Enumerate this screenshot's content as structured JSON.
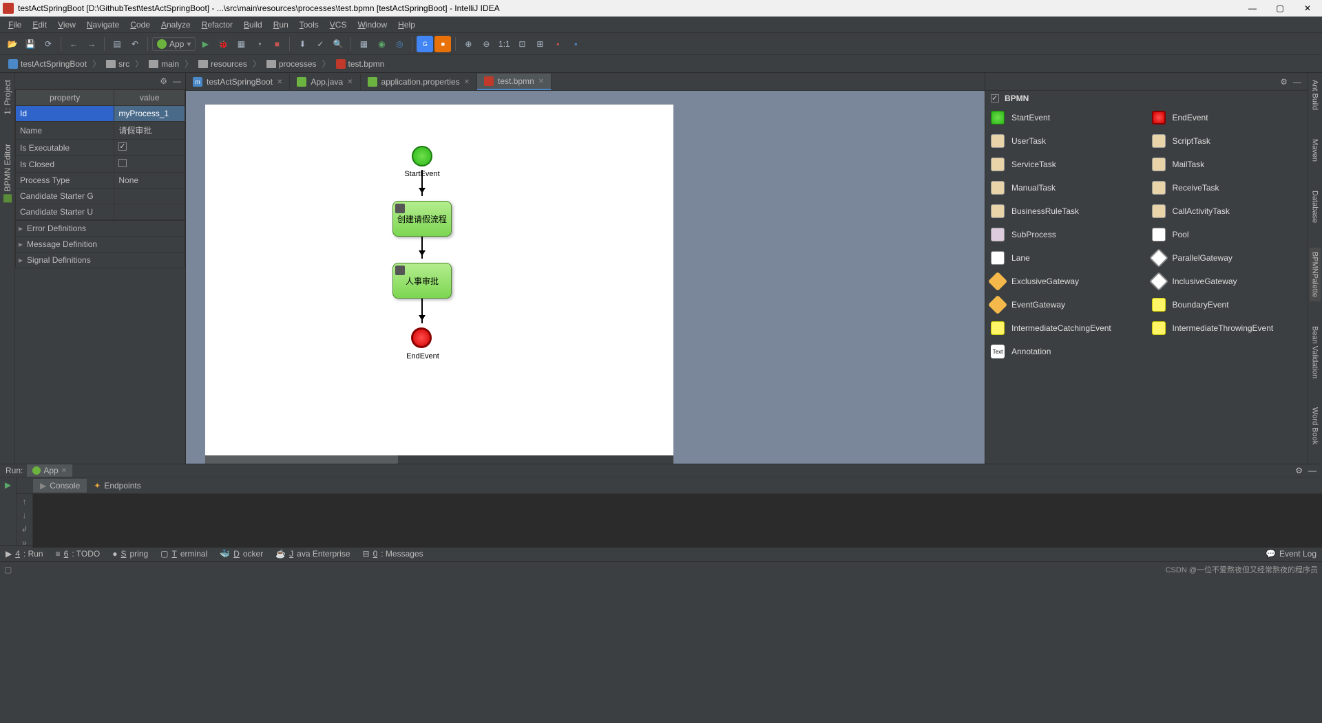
{
  "window": {
    "title": "testActSpringBoot [D:\\GithubTest\\testActSpringBoot] - ...\\src\\main\\resources\\processes\\test.bpmn [testActSpringBoot] - IntelliJ IDEA"
  },
  "menu": [
    "File",
    "Edit",
    "View",
    "Navigate",
    "Code",
    "Analyze",
    "Refactor",
    "Build",
    "Run",
    "Tools",
    "VCS",
    "Window",
    "Help"
  ],
  "run_config": "App",
  "breadcrumb": [
    "testActSpringBoot",
    "src",
    "main",
    "resources",
    "processes",
    "test.bpmn"
  ],
  "left_tabs": [
    "1: Project",
    "BPMN Editor"
  ],
  "right_tabs": [
    "Ant Build",
    "Maven",
    "Database",
    "BPMNPalette",
    "Bean Validation",
    "Word Book"
  ],
  "props": {
    "headers": [
      "property",
      "value"
    ],
    "rows": [
      {
        "k": "Id",
        "v": "myProcess_1",
        "sel": true
      },
      {
        "k": "Name",
        "v": "请假审批"
      },
      {
        "k": "Is Executable",
        "v": "",
        "check": true,
        "checked": true
      },
      {
        "k": "Is Closed",
        "v": "",
        "check": true,
        "checked": false
      },
      {
        "k": "Process Type",
        "v": "None"
      },
      {
        "k": "Candidate Starter G",
        "v": ""
      },
      {
        "k": "Candidate Starter U",
        "v": ""
      }
    ],
    "expandables": [
      "Error Definitions",
      "Message Definition",
      "Signal Definitions"
    ]
  },
  "tabs": [
    {
      "label": "testActSpringBoot",
      "icon": "#4a88c7",
      "letter": "m",
      "active": false
    },
    {
      "label": "App.java",
      "icon": "#6db33f",
      "active": false
    },
    {
      "label": "application.properties",
      "icon": "#6db33f",
      "active": false
    },
    {
      "label": "test.bpmn",
      "icon": "#c0392b",
      "active": true
    }
  ],
  "diagram": {
    "start_label": "StartEvent",
    "task1": "创建请假流程",
    "task2": "人事审批",
    "end_label": "EndEvent"
  },
  "palette": {
    "section": "BPMN",
    "items": [
      {
        "label": "StartEvent",
        "cls": "ic-start"
      },
      {
        "label": "EndEvent",
        "cls": "ic-end"
      },
      {
        "label": "UserTask",
        "cls": "ic-task"
      },
      {
        "label": "ScriptTask",
        "cls": "ic-task"
      },
      {
        "label": "ServiceTask",
        "cls": "ic-task"
      },
      {
        "label": "MailTask",
        "cls": "ic-task"
      },
      {
        "label": "ManualTask",
        "cls": "ic-task"
      },
      {
        "label": "ReceiveTask",
        "cls": "ic-task"
      },
      {
        "label": "BusinessRuleTask",
        "cls": "ic-task"
      },
      {
        "label": "CallActivityTask",
        "cls": "ic-task"
      },
      {
        "label": "SubProcess",
        "cls": "ic-sub"
      },
      {
        "label": "Pool",
        "cls": "ic-pool"
      },
      {
        "label": "Lane",
        "cls": "ic-pool"
      },
      {
        "label": "ParallelGateway",
        "cls": "ic-gw-white"
      },
      {
        "label": "ExclusiveGateway",
        "cls": "ic-gw"
      },
      {
        "label": "InclusiveGateway",
        "cls": "ic-gw-white"
      },
      {
        "label": "EventGateway",
        "cls": "ic-gw"
      },
      {
        "label": "BoundaryEvent",
        "cls": "ic-evt"
      },
      {
        "label": "IntermediateCatchingEvent",
        "cls": "ic-evt"
      },
      {
        "label": "IntermediateThrowingEvent",
        "cls": "ic-evt"
      },
      {
        "label": "Annotation",
        "cls": "ic-annot"
      }
    ]
  },
  "run_panel": {
    "title": "Run:",
    "config": "App",
    "tabs": [
      "Console",
      "Endpoints"
    ]
  },
  "bottom_tabs": [
    {
      "label": "4: Run",
      "pre": "▶"
    },
    {
      "label": "6: TODO",
      "pre": "≡"
    },
    {
      "label": "Spring",
      "pre": "●"
    },
    {
      "label": "Terminal",
      "pre": "▢"
    },
    {
      "label": "Docker",
      "pre": "🐳"
    },
    {
      "label": "Java Enterprise",
      "pre": "☕"
    },
    {
      "label": "0: Messages",
      "pre": "⊟"
    }
  ],
  "event_log": "Event Log",
  "watermark": "CSDN @一位不爱熬夜但又经常熬夜的程序员"
}
